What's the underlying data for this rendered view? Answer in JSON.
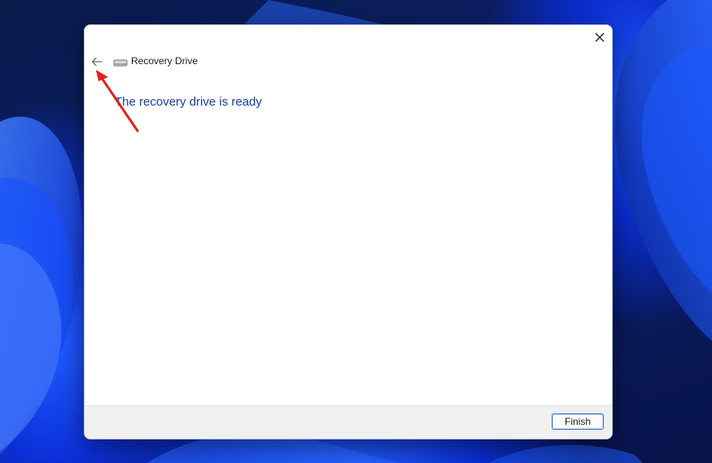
{
  "window": {
    "title": "Recovery Drive",
    "close_icon": "close-icon",
    "back_icon": "back-arrow-icon",
    "app_icon": "drive-icon"
  },
  "content": {
    "heading": "The recovery drive is ready"
  },
  "footer": {
    "finish_label": "Finish"
  },
  "colors": {
    "heading": "#1a3b9c",
    "annotation_arrow": "#e0211e",
    "button_border": "#2f69c6"
  }
}
